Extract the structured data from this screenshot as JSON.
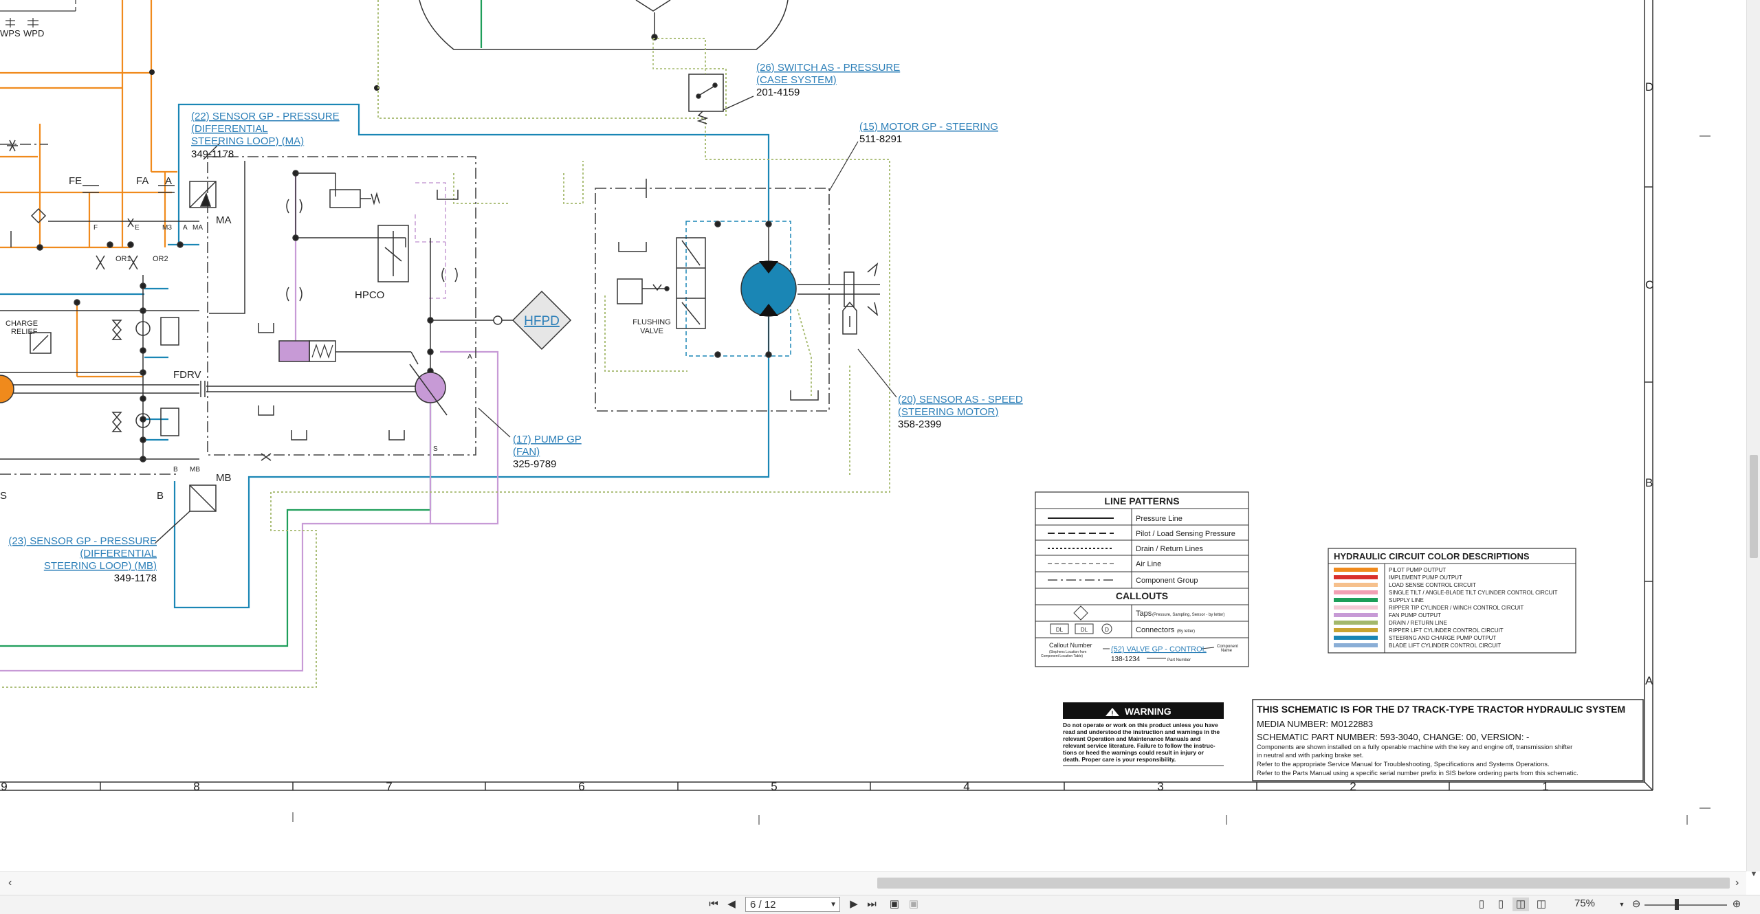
{
  "schematic": {
    "margin_rows": [
      "D",
      "C",
      "B",
      "A"
    ],
    "margin_cols": [
      "9",
      "8",
      "7",
      "6",
      "5",
      "4",
      "3",
      "2",
      "1"
    ],
    "components": {
      "sensor_22": {
        "l1": "(22) SENSOR GP - PRESSURE",
        "l2": "(DIFFERENTIAL",
        "l3": "STEERING LOOP) (MA)",
        "part": "349-1178"
      },
      "switch_26": {
        "l1": "(26) SWITCH AS - PRESSURE",
        "l2": "(CASE SYSTEM)",
        "part": "201-4159"
      },
      "motor_15": {
        "l1": "(15) MOTOR GP - STEERING",
        "part": "511-8291"
      },
      "sensor_20": {
        "l1": "(20) SENSOR AS - SPEED",
        "l2": "(STEERING MOTOR)",
        "part": "358-2399"
      },
      "pump_17": {
        "l1": "(17) PUMP GP",
        "l2": "(FAN)",
        "part": "325-9789"
      },
      "sensor_23": {
        "l1": "(23) SENSOR GP - PRESSURE",
        "l2": "(DIFFERENTIAL",
        "l3": "STEERING LOOP) (MB)",
        "part": "349-1178"
      }
    },
    "labels": {
      "wps": "WPS",
      "wpd": "WPD",
      "fe": "FE",
      "fa": "FA",
      "a": "A",
      "ma": "MA",
      "f": "F",
      "e": "E",
      "m3": "M3",
      "a2": "A",
      "ma2": "MA",
      "or1": "OR1",
      "or2": "OR2",
      "charge1": "CHARGE",
      "charge2": "RELIEF",
      "fdrv": "FDRV",
      "hpco": "HPCO",
      "hfpd": "HFPD",
      "flush1": "FLUSHING",
      "flush2": "VALVE",
      "mb": "MB",
      "b": "B",
      "b2": "B",
      "mb2": "MB",
      "s": "S",
      "s2": "S",
      "a3": "A"
    },
    "line_patterns": {
      "title": "LINE PATTERNS",
      "rows": [
        "Pressure Line",
        "Pilot / Load Sensing Pressure",
        "Drain / Return Lines",
        "Air Line",
        "Component Group"
      ],
      "callouts_title": "CALLOUTS",
      "taps_label": "Taps",
      "taps_note": "(Pressure, Sampling, Sensor - by letter)",
      "connectors_label": "Connectors",
      "connectors_note": "(By letter)",
      "conn_a": "DL",
      "conn_b": "DL",
      "conn_c": "D",
      "callout_number": "Callout Number",
      "callout_note1": "(Stephens Location from",
      "callout_note2": "Component Location Table)",
      "example_link": "(52) VALVE GP - CONTROL",
      "example_part": "138-1234",
      "component_name1": "Component",
      "component_name2": "Name",
      "part_number": "Part Number"
    },
    "color_desc": {
      "title": "HYDRAULIC CIRCUIT COLOR DESCRIPTIONS",
      "rows": [
        {
          "color": "#f08a1c",
          "label": "PILOT PUMP OUTPUT"
        },
        {
          "color": "#d9302b",
          "label": "IMPLEMENT PUMP OUTPUT"
        },
        {
          "color": "#f6c08c",
          "label": "LOAD SENSE CONTROL CIRCUIT"
        },
        {
          "color": "#f2a0b4",
          "label": "SINGLE TILT / ANGLE-BLADE TILT CYLINDER CONTROL CIRCUIT"
        },
        {
          "color": "#1e9e5a",
          "label": "SUPPLY LINE"
        },
        {
          "color": "#f5c9d6",
          "label": "RIPPER TIP CYLINDER / WINCH CONTROL CIRCUIT"
        },
        {
          "color": "#c79ad6",
          "label": "FAN PUMP OUTPUT"
        },
        {
          "color": "#a3b86b",
          "label": "DRAIN / RETURN LINE"
        },
        {
          "color": "#c9a431",
          "label": "RIPPER LIFT CYLINDER CONTROL CIRCUIT"
        },
        {
          "color": "#1a86b5",
          "label": "STEERING AND CHARGE PUMP OUTPUT"
        },
        {
          "color": "#8aaed6",
          "label": "BLADE LIFT CYLINDER CONTROL CIRCUIT"
        }
      ]
    },
    "warning": {
      "title": "WARNING",
      "lines": [
        "Do not operate or work on this product unless you have",
        "read and understood the instruction and warnings in the",
        "relevant Operation and Maintenance Manuals and",
        "relevant service literature. Failure to follow the instruc-",
        "tions or heed the warnings could result in injury or",
        "death. Proper care is your responsibility."
      ]
    },
    "title_block": {
      "title": "THIS SCHEMATIC IS FOR THE D7 TRACK-TYPE TRACTOR HYDRAULIC SYSTEM",
      "media": "MEDIA NUMBER: M0122883",
      "schem": "SCHEMATIC PART NUMBER: 593-3040, CHANGE: 00, VERSION: -",
      "notes": [
        "Components are shown installed on a fully operable machine with the key and engine off, transmission shifter",
        "in neutral and with parking brake set.",
        "Refer to the appropriate Service Manual for Troubleshooting, Specifications and Systems Operations.",
        "Refer to the Parts Manual using a specific serial number prefix in SIS before ordering parts from this schematic."
      ]
    },
    "colors": {
      "steering": "#1a86b5",
      "pilot": "#f08a1c",
      "fan": "#c79ad6",
      "supply": "#1e9e5a",
      "drain": "#a3b86b",
      "pink": "#c9a1d6"
    }
  },
  "viewer": {
    "page_value": "6 / 12",
    "zoom": "75%",
    "icons": {
      "first": "first-page-icon",
      "prev": "previous-page-icon",
      "next": "next-page-icon",
      "last": "last-page-icon",
      "scroll_left": "scroll-left-icon",
      "scroll_right": "scroll-right-icon",
      "scroll_down": "scroll-down-icon"
    }
  }
}
